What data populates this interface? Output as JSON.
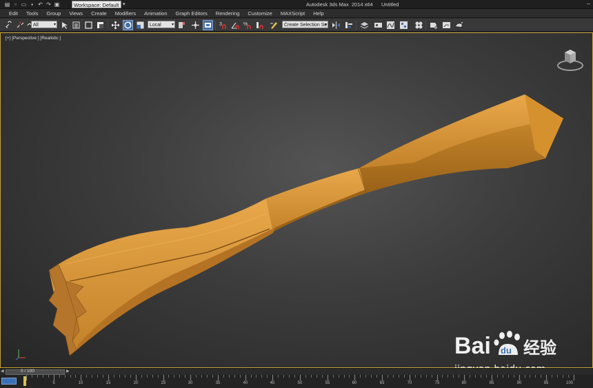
{
  "titlebar": {
    "workspace": "Workspace: Default",
    "app_title": "Autodesk 3ds Max  2014 x64",
    "doc_title": "Untitled"
  },
  "menu": [
    "Edit",
    "Tools",
    "Group",
    "Views",
    "Create",
    "Modifiers",
    "Animation",
    "Graph Editors",
    "Rendering",
    "Customize",
    "MAXScript",
    "Help"
  ],
  "toolbar": {
    "selection_filter": "All",
    "reference_coord": "Local",
    "named_selection_placeholder": "Create Selection Se"
  },
  "viewport": {
    "label": "[+] [Perspective ] [Realistic ]",
    "object_color": "#c98a2e",
    "frame_color": "#c9a43a"
  },
  "watermark": {
    "logo_text": "Bai",
    "logo_text2": "du",
    "logo_cn": "经验",
    "url": "jingyan.baidu.com"
  },
  "timeline": {
    "readout": "0 / 100",
    "ticks": [
      "5",
      "10",
      "15",
      "20",
      "25",
      "30",
      "35",
      "40",
      "45",
      "50",
      "55",
      "60",
      "65",
      "70",
      "75",
      "80",
      "85",
      "90",
      "95",
      "100"
    ]
  },
  "icons": [
    "new-file-icon",
    "open-icon",
    "save-icon",
    "undo-icon",
    "redo-icon",
    "project-icon",
    "link-icon",
    "unlink-icon",
    "bind-icon",
    "select-icon",
    "select-by-name-icon",
    "region-select-icon",
    "window-crossing-icon",
    "move-icon",
    "rotate-icon",
    "scale-icon",
    "pivot-icon",
    "manipulate-icon",
    "keyboard-shortcut-icon",
    "snap-icon",
    "angle-snap-icon",
    "percent-snap-icon",
    "spinner-snap-icon",
    "edit-named-selection-icon",
    "mirror-icon",
    "align-icon",
    "layer-icon",
    "graphite-icon",
    "curve-editor-icon",
    "schematic-icon",
    "material-editor-icon",
    "render-setup-icon",
    "rendered-frame-icon",
    "render-icon"
  ]
}
